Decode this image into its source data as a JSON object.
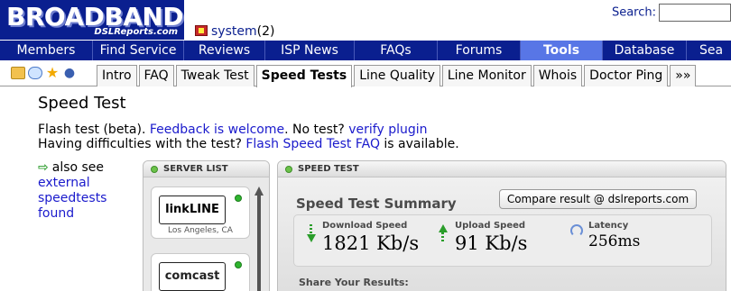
{
  "header": {
    "logo_main": "BROADBAND",
    "logo_sub": "DSLReports.com",
    "user_name": "system",
    "user_count": "(2)",
    "search_label": "Search:",
    "search_value": ""
  },
  "mainnav": {
    "items": [
      "Members",
      "Find Service",
      "Reviews",
      "ISP News",
      "FAQs",
      "Forums",
      "Tools",
      "Database",
      "Sea"
    ],
    "active": "Tools"
  },
  "subnav": {
    "icons": [
      "folder-icon",
      "comment-icon",
      "star-icon",
      "user-icon"
    ],
    "tabs": [
      "Intro",
      "FAQ",
      "Tweak Test",
      "Speed Tests",
      "Line Quality",
      "Line Monitor",
      "Whois",
      "Doctor Ping",
      "»»"
    ],
    "active": "Speed Tests"
  },
  "page": {
    "title": "Speed Test",
    "intro_1a": "Flash test (beta). ",
    "intro_1_link": "Feedback is welcome",
    "intro_1b": ". No test? ",
    "intro_1_link2": "verify plugin",
    "intro_2a": "Having difficulties with the test? ",
    "intro_2_link": "Flash Speed Test FAQ",
    "intro_2b": " is available."
  },
  "aside": {
    "prefix": "also see",
    "link": "external speedtests found"
  },
  "server_list": {
    "title": "SERVER LIST",
    "servers": [
      {
        "name": "linkLINE",
        "city": "Los Angeles, CA"
      },
      {
        "name": "comcast",
        "city": ""
      }
    ]
  },
  "speed_test": {
    "title": "SPEED TEST",
    "summary_title": "Speed Test Summary",
    "compare_label": "Compare result @ dslreports.com",
    "download_label": "Download Speed",
    "download_value": "1821 Kb/s",
    "upload_label": "Upload Speed",
    "upload_value": "91 Kb/s",
    "latency_label": "Latency",
    "latency_value": "256ms",
    "share_label": "Share Your Results:"
  },
  "colors": {
    "nav_bg": "#0a1f8f",
    "nav_active": "#5876e6",
    "link": "#1a1acc",
    "status_green": "#2fb52f"
  }
}
